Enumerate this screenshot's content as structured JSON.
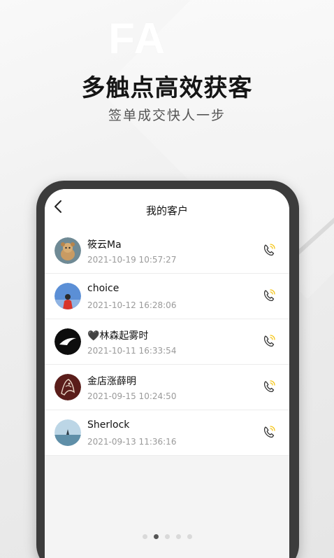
{
  "hero": {
    "watermark": "FA",
    "headline": "多触点高效获客",
    "subline": "签单成交快人一步"
  },
  "header": {
    "title": "我的客户",
    "back_icon": "chevron-left-icon"
  },
  "customers": [
    {
      "name": "筱云Ma",
      "time": "2021-10-19 10:57:27"
    },
    {
      "name": "choice",
      "time": "2021-10-12 16:28:06"
    },
    {
      "name": "🖤林森起雾时",
      "time": "2021-10-11 16:33:54"
    },
    {
      "name": "金店涨薛明",
      "time": "2021-09-15 10:24:50"
    },
    {
      "name": "Sherlock",
      "time": "2021-09-13 11:36:16"
    }
  ],
  "call_icon": "phone-call-icon",
  "pagination": {
    "total": 5,
    "active_index": 1
  },
  "colors": {
    "accent": "#f5c518",
    "headline": "#151515",
    "secondary_text": "#9a9a9a"
  }
}
